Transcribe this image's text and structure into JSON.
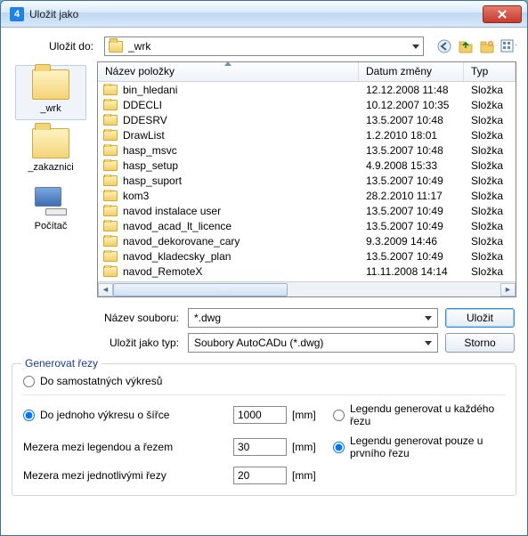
{
  "window": {
    "title": "Uložit jako",
    "app_badge": "4"
  },
  "toolbar": {
    "save_in_label": "Uložit do:",
    "current_folder": "_wrk",
    "icons": {
      "back": "back-icon",
      "up": "up-one-level-icon",
      "new_folder": "new-folder-icon",
      "view_menu": "view-menu-icon"
    }
  },
  "places": [
    {
      "label": "_wrk",
      "kind": "folder",
      "selected": true
    },
    {
      "label": "_zakaznici",
      "kind": "folder",
      "selected": false
    },
    {
      "label": "Počítač",
      "kind": "computer",
      "selected": false
    }
  ],
  "columns": {
    "name": "Název položky",
    "date": "Datum změny",
    "type": "Typ"
  },
  "files": [
    {
      "name": "bin_hledani",
      "date": "12.12.2008 11:48",
      "type": "Složka"
    },
    {
      "name": "DDECLI",
      "date": "10.12.2007 10:35",
      "type": "Složka"
    },
    {
      "name": "DDESRV",
      "date": "13.5.2007 10:48",
      "type": "Složka"
    },
    {
      "name": "DrawList",
      "date": "1.2.2010 18:01",
      "type": "Složka"
    },
    {
      "name": "hasp_msvc",
      "date": "13.5.2007 10:48",
      "type": "Složka"
    },
    {
      "name": "hasp_setup",
      "date": "4.9.2008 15:33",
      "type": "Složka"
    },
    {
      "name": "hasp_suport",
      "date": "13.5.2007 10:49",
      "type": "Složka"
    },
    {
      "name": "kom3",
      "date": "28.2.2010 11:17",
      "type": "Složka"
    },
    {
      "name": "navod instalace user",
      "date": "13.5.2007 10:49",
      "type": "Složka"
    },
    {
      "name": "navod_acad_lt_licence",
      "date": "13.5.2007 10:49",
      "type": "Složka"
    },
    {
      "name": "navod_dekorovane_cary",
      "date": "9.3.2009 14:46",
      "type": "Složka"
    },
    {
      "name": "navod_kladecsky_plan",
      "date": "13.5.2007 10:49",
      "type": "Složka"
    },
    {
      "name": "navod_RemoteX",
      "date": "11.11.2008 14:14",
      "type": "Složka"
    }
  ],
  "fields": {
    "filename_label": "Název souboru:",
    "filename_value": "*.dwg",
    "filetype_label": "Uložit jako typ:",
    "filetype_value": "Soubory AutoCADu (*.dwg)",
    "save_button": "Uložit",
    "cancel_button": "Storno"
  },
  "group": {
    "legend": "Generovat řezy",
    "opt_separate": "Do samostatných výkresů",
    "opt_single": "Do jednoho výkresu o šířce",
    "width_value": "1000",
    "gap_legend_label": "Mezera mezi legendou a řezem",
    "gap_legend_value": "30",
    "gap_cuts_label": "Mezera mezi jednotlivými řezy",
    "gap_cuts_value": "20",
    "unit": "[mm]",
    "legend_each": "Legendu generovat u každého řezu",
    "legend_first": "Legendu generovat pouze u prvního řezu"
  }
}
